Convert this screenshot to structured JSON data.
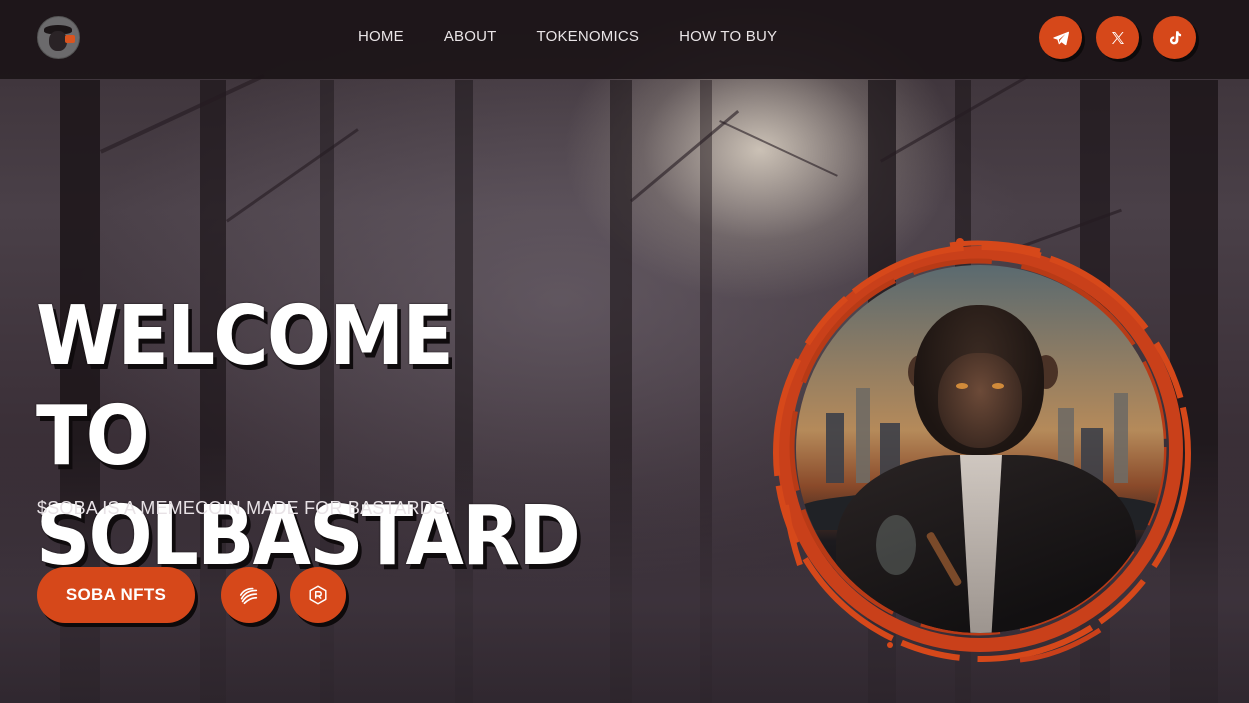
{
  "header": {
    "logo_icon": "soba-logo-avatar",
    "nav": [
      {
        "label": "HOME"
      },
      {
        "label": "ABOUT"
      },
      {
        "label": "TOKENOMICS"
      },
      {
        "label": "HOW TO BUY"
      }
    ],
    "socials": [
      {
        "icon": "telegram-icon"
      },
      {
        "icon": "x-twitter-icon"
      },
      {
        "icon": "tiktok-icon"
      }
    ]
  },
  "hero": {
    "title_line1": "WELCOME TO",
    "title_line2": "SOLBASTARD",
    "subtitle": "$SOBA IS A MEMECOIN MADE FOR BASTARDS.",
    "cta_label": "SOBA NFTS",
    "icon_buttons": [
      {
        "icon": "magic-eden-icon"
      },
      {
        "icon": "raydium-icon"
      }
    ],
    "portrait_icon": "chimpanzee-in-suit-portrait"
  },
  "colors": {
    "accent": "#d6481a",
    "nav_bg": "#1c1418",
    "text": "#ffffff"
  }
}
